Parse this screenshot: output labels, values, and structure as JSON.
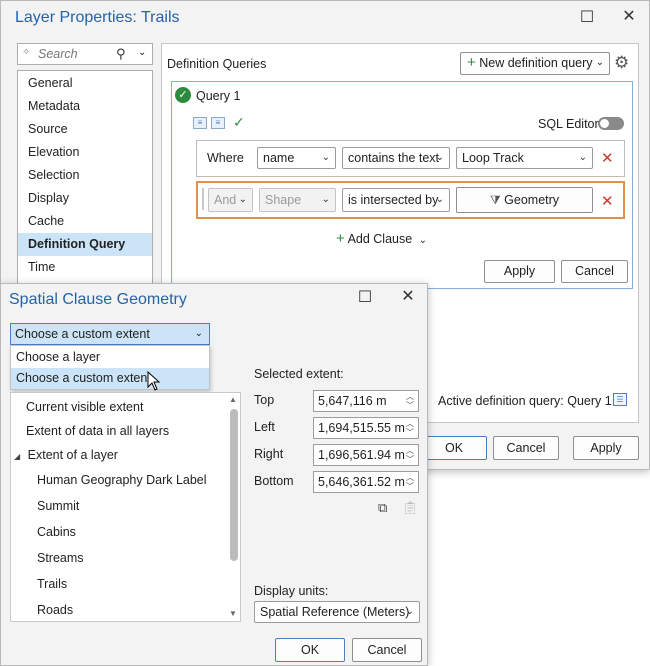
{
  "main_window": {
    "title": "Layer Properties: Trails",
    "search_placeholder": "Search",
    "sidebar_items": [
      "General",
      "Metadata",
      "Source",
      "Elevation",
      "Selection",
      "Display",
      "Cache",
      "Definition Query",
      "Time"
    ],
    "selected_item": "Definition Query",
    "section_title": "Definition Queries",
    "new_query_label": "New definition query",
    "query_name": "Query 1",
    "sql_editor_label": "SQL Editor",
    "clause1": {
      "prefix": "Where",
      "field": "name",
      "operator": "contains the text",
      "value": "Loop Track"
    },
    "clause2": {
      "logic": "And",
      "field": "Shape",
      "operator": "is intersected by",
      "value": "Geometry"
    },
    "add_clause_label": "Add Clause",
    "query_apply": "Apply",
    "query_cancel": "Cancel",
    "active_query": "Active definition query: Query 1",
    "ok": "OK",
    "cancel": "Cancel",
    "apply": "Apply"
  },
  "geometry_dialog": {
    "title": "Spatial Clause Geometry",
    "dropdown_value": "Choose a custom extent",
    "dropdown_options": [
      "Choose a layer",
      "Choose a custom extent"
    ],
    "highlighted_option": "Choose a custom extent",
    "tree": {
      "current_visible_extent": "Current visible extent",
      "extent_all_layers": "Extent of data in all layers",
      "extent_of_layer": "Extent of a layer",
      "layers": [
        "Human Geography Dark Label",
        "Summit",
        "Cabins",
        "Streams",
        "Trails",
        "Roads"
      ]
    },
    "selected_extent_label": "Selected extent:",
    "extent": {
      "top_label": "Top",
      "top_value": "5,647,116 m",
      "left_label": "Left",
      "left_value": "1,694,515.55 m",
      "right_label": "Right",
      "right_value": "1,696,561.94 m",
      "bottom_label": "Bottom",
      "bottom_value": "5,646,361.52 m"
    },
    "display_units_label": "Display units:",
    "display_units_value": "Spatial Reference (Meters)",
    "ok": "OK",
    "cancel": "Cancel"
  },
  "colors": {
    "title_blue": "#2563a8",
    "highlight_border": "#e0914a",
    "selected_bg": "#cce4f7",
    "check_green": "#2e8b3e",
    "remove_red": "#c43c2c"
  }
}
